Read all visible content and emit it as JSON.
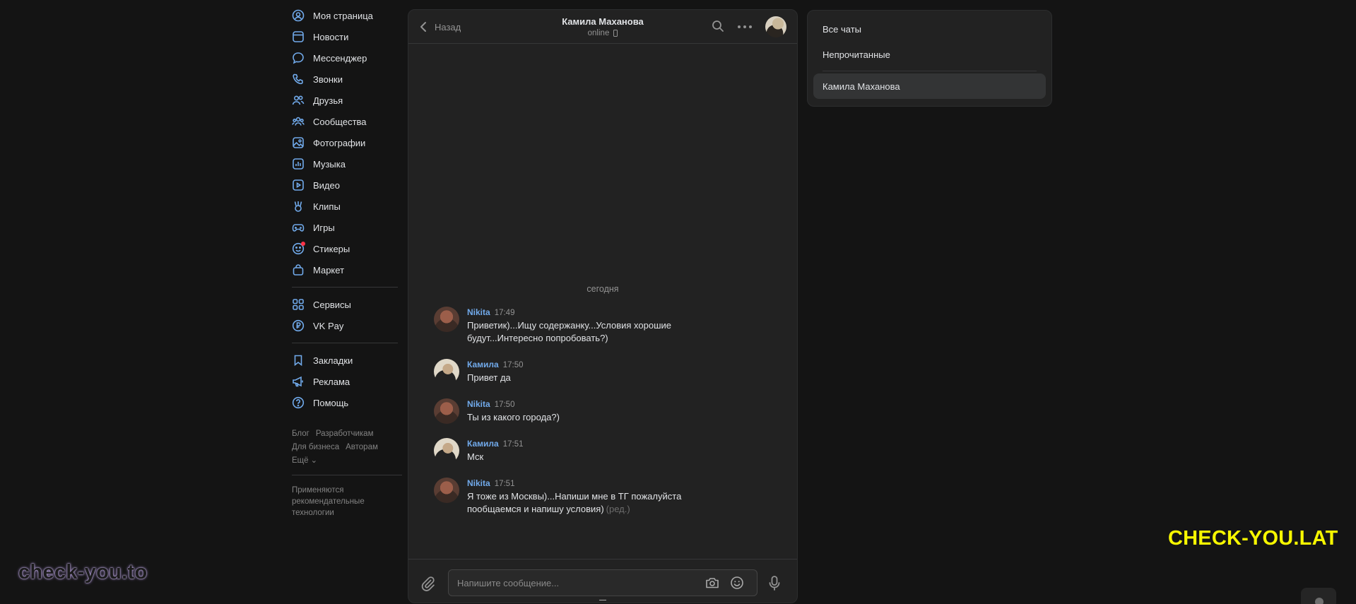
{
  "sidebar": {
    "items": [
      {
        "label": "Моя страница",
        "icon": "user-circle-icon"
      },
      {
        "label": "Новости",
        "icon": "news-icon"
      },
      {
        "label": "Мессенджер",
        "icon": "message-icon"
      },
      {
        "label": "Звонки",
        "icon": "phone-icon"
      },
      {
        "label": "Друзья",
        "icon": "friends-icon"
      },
      {
        "label": "Сообщества",
        "icon": "groups-icon"
      },
      {
        "label": "Фотографии",
        "icon": "photo-icon"
      },
      {
        "label": "Музыка",
        "icon": "music-icon"
      },
      {
        "label": "Видео",
        "icon": "video-icon"
      },
      {
        "label": "Клипы",
        "icon": "clips-icon"
      },
      {
        "label": "Игры",
        "icon": "gamepad-icon"
      },
      {
        "label": "Стикеры",
        "icon": "sticker-icon"
      },
      {
        "label": "Маркет",
        "icon": "market-bag-icon"
      }
    ],
    "items2": [
      {
        "label": "Сервисы",
        "icon": "services-grid-icon"
      },
      {
        "label": "VK Pay",
        "icon": "vkpay-icon"
      }
    ],
    "items3": [
      {
        "label": "Закладки",
        "icon": "bookmark-icon"
      },
      {
        "label": "Реклама",
        "icon": "megaphone-icon"
      },
      {
        "label": "Помощь",
        "icon": "help-icon"
      }
    ],
    "footer_links": [
      "Блог",
      "Разработчикам",
      "Для бизнеса",
      "Авторам",
      "Ещё"
    ],
    "footer_note": "Применяются рекомендательные технологии"
  },
  "chat": {
    "back_label": "Назад",
    "contact_name": "Камила Маханова",
    "contact_status": "online",
    "day_label": "сегодня",
    "messages": [
      {
        "author": "Nikita",
        "time": "17:49",
        "text": "Приветик)...Ищу содержанку...Условия хорошие будут...Интересно попробовать?)",
        "edited": ""
      },
      {
        "author": "Камила",
        "time": "17:50",
        "text": "Привет да",
        "edited": ""
      },
      {
        "author": "Nikita",
        "time": "17:50",
        "text": "Ты из какого города?)",
        "edited": ""
      },
      {
        "author": "Камила",
        "time": "17:51",
        "text": "Мск",
        "edited": ""
      },
      {
        "author": "Nikita",
        "time": "17:51",
        "text": "Я тоже из Москвы)...Напиши мне в ТГ пожалуйста пообщаемся и напишу условия)",
        "edited": "(ред.)"
      }
    ],
    "input_placeholder": "Напишите сообщение..."
  },
  "filters": {
    "items": [
      "Все чаты",
      "Непрочитанные"
    ],
    "active": "Камила Маханова"
  },
  "watermarks": {
    "left": "check-you.to",
    "right": "CHECK-YOU.LAT"
  },
  "colors": {
    "accent": "#71aaeb",
    "background": "#141414",
    "panel": "#222222",
    "watermark_yellow": "#f7f700"
  }
}
